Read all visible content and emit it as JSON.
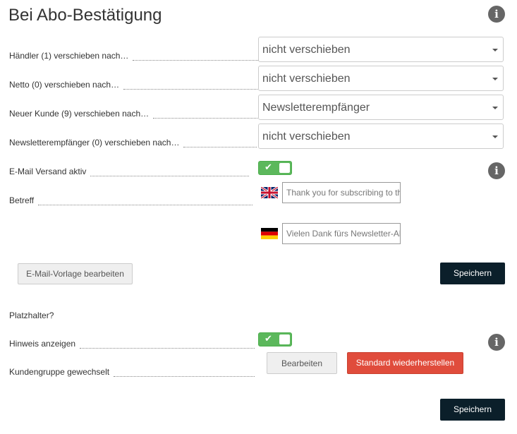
{
  "section": {
    "title": "Bei Abo-Bestätigung",
    "info_icon": "info-icon"
  },
  "rows": [
    {
      "label": "Händler (1) verschieben nach…",
      "value": "nicht verschieben"
    },
    {
      "label": "Netto (0) verschieben nach…",
      "value": "nicht verschieben"
    },
    {
      "label": "Neuer Kunde (9) verschieben nach…",
      "value": "Newsletterempfänger"
    },
    {
      "label": "Newsletterempfänger (0) verschieben nach…",
      "value": "nicht verschieben"
    }
  ],
  "email": {
    "active_label": "E-Mail Versand aktiv",
    "active_on": true,
    "subject_label": "Betreff",
    "subject_en": "Thank you for subscribing to the newsletter",
    "subject_de": "Vielen Dank fürs Newsletter-Abonnement",
    "edit_template_button": "E-Mail-Vorlage bearbeiten",
    "save_button": "Speichern"
  },
  "placeholder": {
    "heading": "Platzhalter?",
    "hint_label": "Hinweis anzeigen",
    "hint_on": true,
    "group_label": "Kundengruppe gewechselt",
    "edit_button": "Bearbeiten",
    "restore_button": "Standard wiederherstellen",
    "save_button": "Speichern"
  },
  "colors": {
    "toggle_on": "#5cb85c",
    "save_bg": "#0b1f2a",
    "restore_bg": "#e04c3c",
    "info_icon": "#666666"
  }
}
